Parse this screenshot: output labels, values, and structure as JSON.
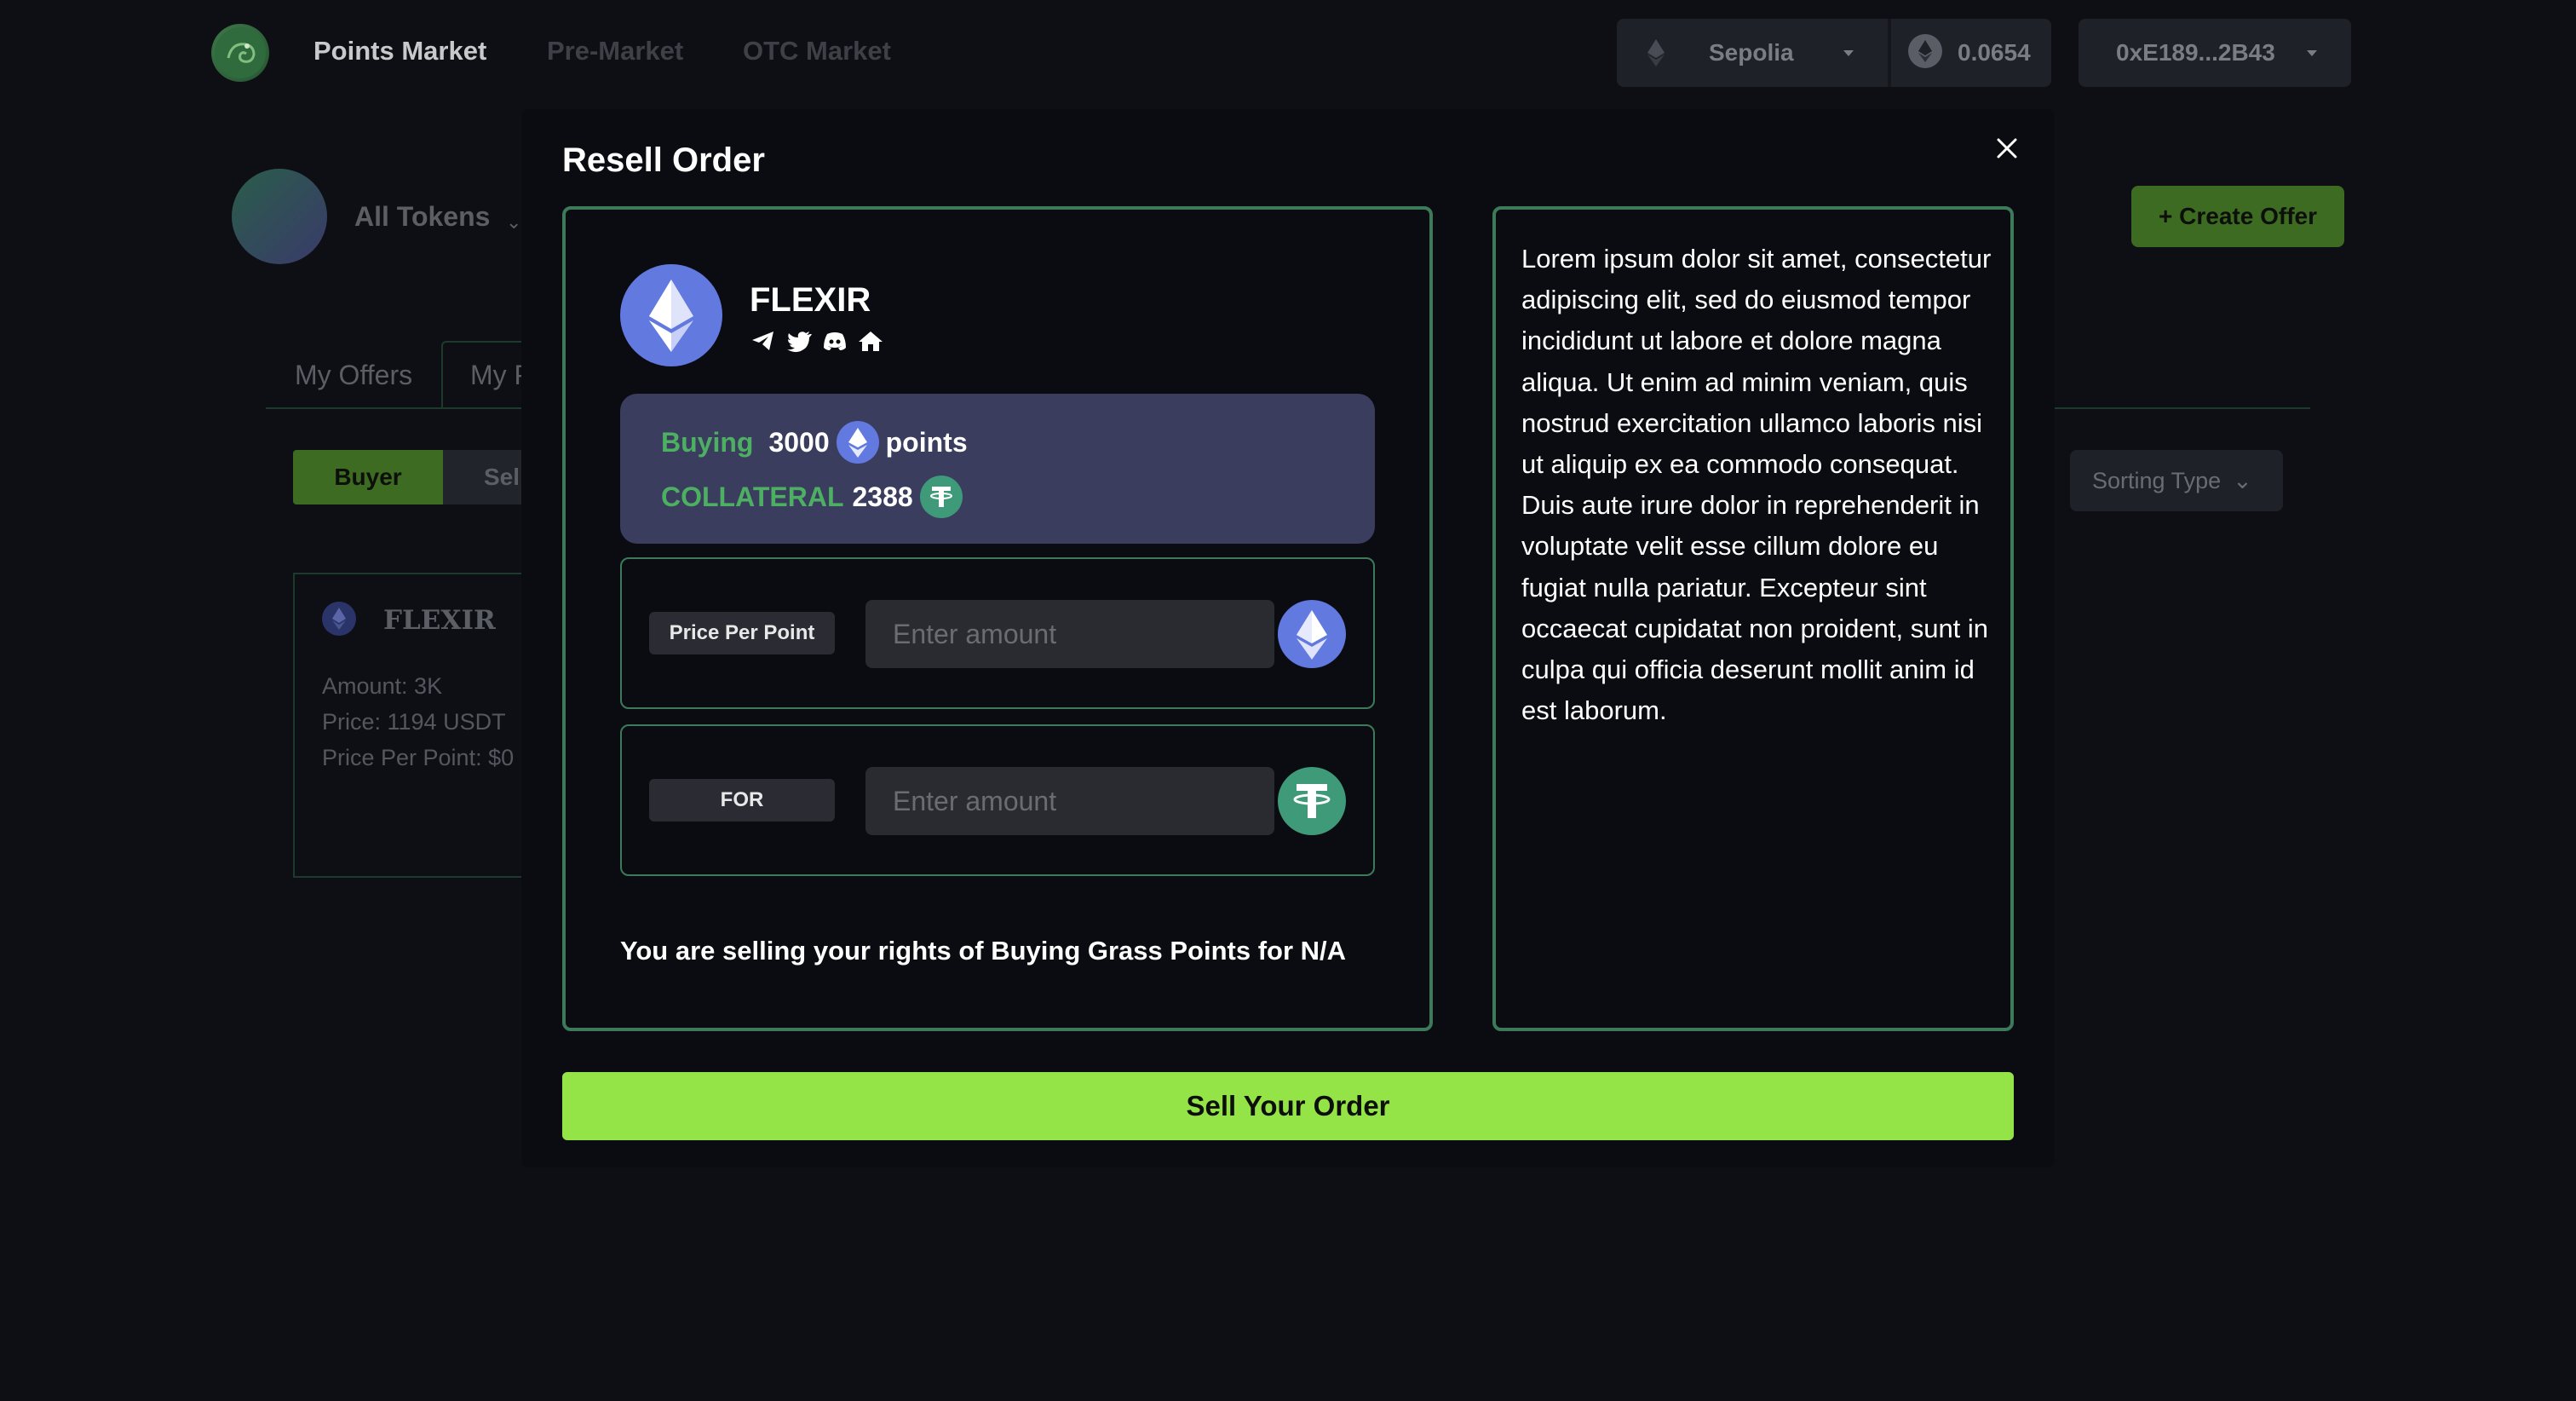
{
  "topbar": {
    "nav": [
      "Points Market",
      "Pre-Market",
      "OTC Market"
    ],
    "network": "Sepolia",
    "balance": "0.0654",
    "wallet": "0xE189...2B43"
  },
  "page": {
    "token_filter": "All Tokens",
    "create_offer": "+ Create Offer",
    "tabs": [
      "My Offers",
      "My P"
    ],
    "buyer": "Buyer",
    "seller": "Sel",
    "sorting": "Sorting Type",
    "offer_card": {
      "name": "FLEXIR",
      "amount": "Amount: 3K",
      "price": "Price:  1194 USDT",
      "ppp": "Price Per Point: $0"
    }
  },
  "modal": {
    "title": "Resell Order",
    "token": {
      "name": "FLEXIR"
    },
    "summary": {
      "buying_label": "Buying",
      "buying_amount": "3000",
      "points_label": "points",
      "collateral_label": "COLLATERAL",
      "collateral_amount": "2388"
    },
    "price_per_point": {
      "label": "Price Per Point",
      "placeholder": "Enter amount"
    },
    "for_field": {
      "label": "FOR",
      "placeholder": "Enter amount"
    },
    "notice": "You are selling your rights of Buying Grass Points for N/A",
    "description": "Lorem ipsum dolor sit amet, consectetur adipiscing elit, sed do eiusmod tempor incididunt ut labore et dolore magna aliqua. Ut enim ad minim veniam, quis nostrud exercitation ullamco laboris nisi ut aliquip ex ea commodo consequat. Duis aute irure dolor in reprehenderit in voluptate velit esse cillum dolore eu fugiat nulla pariatur. Excepteur sint occaecat cupidatat non proident, sunt in culpa qui officia deserunt mollit anim id est laborum.",
    "submit": "Sell Your Order"
  },
  "colors": {
    "accent_green": "#94e347",
    "panel_border": "#3c7a5a",
    "label_green": "#4caf62",
    "eth_blue": "#6279e0",
    "usdt_green": "#3f9a7a"
  }
}
